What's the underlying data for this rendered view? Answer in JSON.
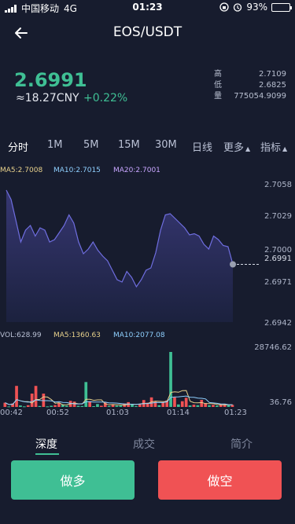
{
  "status_bar": {
    "carrier": "中国移动",
    "network": "4G",
    "time": "01:23",
    "battery": "93%",
    "battery_level": 0.93
  },
  "header": {
    "title": "EOS/USDT",
    "back_icon": "back-arrow-icon"
  },
  "ticker": {
    "price": "2.6991",
    "cny": "≈18.27CNY",
    "change": "+0.22%",
    "high_label": "高",
    "high": "2.7109",
    "low_label": "低",
    "low": "2.6825",
    "volume_label": "量",
    "volume": "775054.9099"
  },
  "tabs": [
    {
      "label": "分时",
      "active": true
    },
    {
      "label": "1M",
      "active": false
    },
    {
      "label": "5M",
      "active": false
    },
    {
      "label": "15M",
      "active": false
    },
    {
      "label": "30M",
      "active": false
    },
    {
      "label": "日线",
      "active": false
    },
    {
      "label": "更多",
      "active": false
    },
    {
      "label": "指标",
      "active": false
    }
  ],
  "ma_indicators": {
    "ma5": "MA5:2.7008",
    "ma10": "MA10:2.7015",
    "ma20": "MA20:2.7001"
  },
  "vol_indicators": {
    "vol": "VOL:628.99",
    "ma5": "MA5:1360.63",
    "ma10": "MA10:2077.08"
  },
  "colors": {
    "up": "#3fbf94",
    "down": "#f05254",
    "line": "#6f6ee0",
    "background": "#171c2e"
  },
  "chart_data": [
    {
      "type": "area",
      "y_ticks": [
        "2.7058",
        "2.7029",
        "2.7000",
        "2.6971",
        "2.6942"
      ],
      "current_value": "2.6991",
      "ylim": [
        2.6942,
        2.7058
      ],
      "x_labels": [
        "00:42",
        "00:52",
        "01:03",
        "01:14",
        "01:23"
      ],
      "values": [
        2.7054,
        2.7046,
        2.7028,
        2.701,
        2.702,
        2.7024,
        2.7015,
        2.7022,
        2.702,
        2.701,
        2.7012,
        2.7018,
        2.7024,
        2.7033,
        2.7026,
        2.701,
        2.7,
        2.7004,
        2.701,
        2.7003,
        2.6998,
        2.6994,
        2.6986,
        2.6978,
        2.6976,
        2.6985,
        2.698,
        2.6972,
        2.6978,
        2.6986,
        2.6988,
        2.7001,
        2.702,
        2.7033,
        2.7034,
        2.703,
        2.7026,
        2.7022,
        2.7016,
        2.7017,
        2.7015,
        2.7008,
        2.7004,
        2.7015,
        2.7012,
        2.7007,
        2.7006,
        2.6991
      ]
    },
    {
      "type": "bar",
      "y_ticks": [
        "28746.62",
        "36.76"
      ],
      "ylim": [
        0,
        28746.62
      ],
      "values": [
        2200,
        300,
        1800,
        11000,
        800,
        300,
        900,
        7000,
        11000,
        500,
        7000,
        300,
        600,
        1000,
        2200,
        1300,
        600,
        3200,
        2800,
        600,
        500,
        13000,
        3000,
        400,
        1500,
        600,
        2500,
        500,
        1200,
        700,
        800,
        1800,
        2500,
        1300,
        400,
        1600,
        3600,
        2200,
        5000,
        2800,
        900,
        2200,
        3400,
        28746,
        5000,
        1300,
        3000,
        4800,
        800,
        1200,
        900,
        3700,
        2000,
        900,
        1100,
        700,
        1300,
        1500,
        900,
        1100
      ],
      "up": [
        false,
        true,
        false,
        false,
        true,
        true,
        false,
        false,
        false,
        true,
        false,
        true,
        true,
        false,
        false,
        true,
        true,
        false,
        false,
        true,
        true,
        true,
        false,
        true,
        true,
        false,
        false,
        true,
        false,
        true,
        true,
        false,
        false,
        true,
        true,
        false,
        false,
        false,
        false,
        false,
        true,
        false,
        false,
        true,
        false,
        true,
        false,
        false,
        true,
        false,
        true,
        false,
        false,
        true,
        false,
        true,
        false,
        false,
        true,
        false
      ],
      "ma5": [
        2200,
        1250,
        1433,
        3825,
        3220,
        2840,
        2780,
        2000,
        3840,
        3940,
        5280,
        5160,
        3880,
        1880,
        2220,
        1080,
        1140,
        1660,
        2020,
        1660,
        1540,
        3980,
        3980,
        3460,
        3680,
        3700,
        1600,
        1100,
        1260,
        1100,
        1140,
        1000,
        1400,
        1420,
        1280,
        1520,
        1880,
        1820,
        2620,
        3040,
        2900,
        2740,
        2860,
        7610,
        7880,
        7660,
        8550,
        8570,
        2980,
        2220,
        2140,
        2280,
        1720,
        1740,
        1720,
        1340,
        1200,
        1120,
        1160,
        1140
      ],
      "ma10": [
        2200,
        1250,
        1433,
        3825,
        3220,
        2700,
        2500,
        2800,
        3700,
        3400,
        3300,
        3300,
        3200,
        2600,
        2800,
        2400,
        2300,
        1900,
        1600,
        1500,
        1700,
        2700,
        2700,
        2600,
        2600,
        2600,
        2500,
        2100,
        2100,
        2000,
        1800,
        1600,
        1500,
        1400,
        1300,
        1500,
        1700,
        1800,
        2000,
        2300,
        2300,
        2300,
        2700,
        5000,
        5200,
        5300,
        5500,
        5700,
        5100,
        5000,
        4600,
        4500,
        4200,
        2300,
        2100,
        1900,
        1500,
        1500,
        1200,
        1100
      ]
    }
  ],
  "bottom_tabs": [
    {
      "label": "深度",
      "active": true
    },
    {
      "label": "成交",
      "active": false
    },
    {
      "label": "简介",
      "active": false
    }
  ],
  "actions": {
    "long_label": "做多",
    "short_label": "做空"
  }
}
